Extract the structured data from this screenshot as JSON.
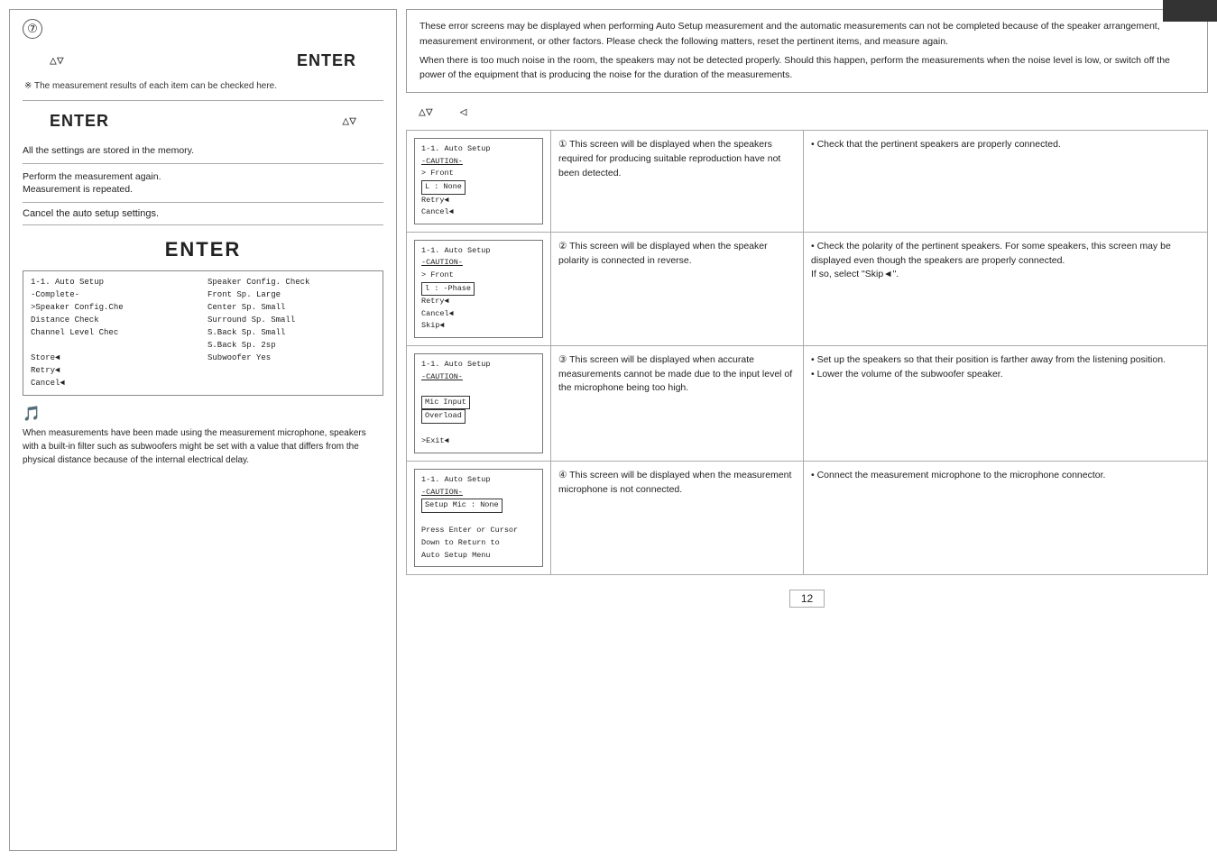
{
  "page": {
    "number": "12",
    "top_right_bar": "dark bar"
  },
  "left_panel": {
    "step_number": "⑦",
    "nav1": {
      "symbol": "△▽",
      "enter": "ENTER"
    },
    "hint": "※ The measurement results of each item can be checked here.",
    "nav2": {
      "enter": "ENTER",
      "symbol": "△▽"
    },
    "storage_text": "All the settings are stored in the memory.",
    "action1": "Perform the measurement again.",
    "action2": "Measurement is repeated.",
    "action3": "Cancel the auto setup settings.",
    "enter_label": "ENTER",
    "screen_left": [
      "1-1. Auto Setup",
      " -Complete-",
      ">Speaker Config.Che",
      " Distance Check",
      " Channel Level Chec",
      "",
      " Store◄",
      " Retry◄",
      " Cancel◄"
    ],
    "screen_right_title": "Speaker Config. Check",
    "screen_right_lines": [
      "Front Sp.    Large",
      "Center Sp.   Small",
      "Surround Sp. Small",
      "S.Back Sp.   Small",
      "S.Back Sp.   2sp",
      "Subwoofer    Yes"
    ],
    "note_icon": "🎵",
    "note_text": "When measurements have been made using the measurement microphone, speakers with a built-in filter such as subwoofers might be set with a value that differs from the physical distance because of the internal electrical delay."
  },
  "right_panel": {
    "top_notes": [
      "These error screens may be displayed when performing Auto Setup measurement and the automatic measurements can not be completed because of the speaker arrangement, measurement environment, or other factors. Please check the following matters, reset the pertinent items, and measure again.",
      "When there is too much noise in the room, the speakers may not be detected properly. Should this happen, perform the measurements when the noise level is low, or switch off the power of the equipment that is producing the noise for the duration of the measurements."
    ],
    "nav": {
      "symbol1": "△▽",
      "symbol2": "◁"
    },
    "errors": [
      {
        "screen_lines": [
          "1-1. Auto Setup",
          " -CAUTION-",
          "> Front",
          " L : None",
          " Retry◄",
          " Cancel◄"
        ],
        "description": "① This screen will be displayed when the speakers required for producing suitable reproduction have not been detected.",
        "remedy": "• Check that the pertinent speakers are properly connected."
      },
      {
        "screen_lines": [
          "1-1. Auto Setup",
          " -CAUTION-",
          "> Front",
          " l : -Phase",
          " Retry◄",
          " Cancel◄",
          " Skip◄"
        ],
        "description": "② This screen will be displayed when the speaker polarity is connected in reverse.",
        "remedy": "• Check the polarity of the pertinent speakers. For some speakers, this screen may be displayed even though the speakers are properly connected.\nIf so, select \"Skip◄\"."
      },
      {
        "screen_lines": [
          "1-1. Auto Setup",
          " -CAUTION-",
          "",
          " Mic Input",
          " Overload",
          "",
          " >Exit◄"
        ],
        "description": "③ This screen will be displayed when accurate measurements cannot be made due to the input level of the microphone being too high.",
        "remedy": "• Set up the speakers so that their position is farther away from the listening position.\n• Lower the volume of the subwoofer speaker."
      },
      {
        "screen_lines": [
          "1-1. Auto Setup",
          " -CAUTION-",
          " Setup Mic : None",
          "",
          " Press Enter or Cursor",
          " Down to Return to",
          " Auto Setup Menu"
        ],
        "description": "④ This screen will be displayed when the measurement microphone is not connected.",
        "remedy": "• Connect the measurement microphone to the microphone connector."
      }
    ]
  }
}
